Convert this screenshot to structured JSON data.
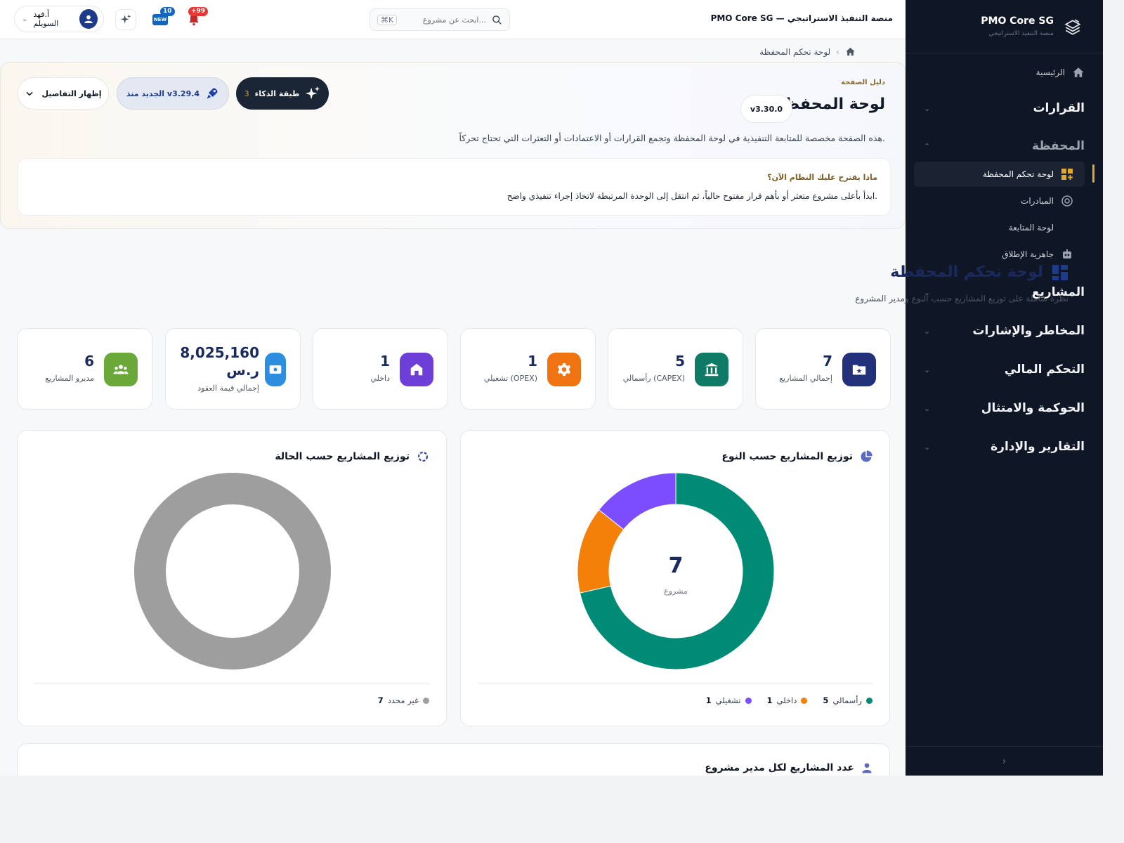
{
  "sidebar": {
    "brand_name": "PMO Core SG",
    "brand_sub": "منصة التنفيذ الاستراتيجي",
    "home_label": "الرئيسية",
    "groups": [
      {
        "label": "القرارات"
      },
      {
        "label": "المحفظة"
      },
      {
        "label": "المشاريع"
      },
      {
        "label": "المخاطر والإشارات"
      },
      {
        "label": "التحكم المالي"
      },
      {
        "label": "الحوكمة والامتثال"
      },
      {
        "label": "التقارير والإدارة"
      }
    ],
    "sub_items": [
      {
        "label": "لوحة تحكم المحفظة",
        "icon": "dashboard-icon"
      },
      {
        "label": "المبادرات",
        "icon": "initiatives-icon"
      },
      {
        "label": "لوحة المتابعة",
        "icon": ""
      },
      {
        "label": "جاهزية الإطلاق",
        "icon": "robot-icon"
      }
    ],
    "collapse_glyph": "›"
  },
  "topbar": {
    "title": "PMO Core SG — منصة التنفيذ الاستراتيجي",
    "search_placeholder": "ابحث عن مشروع...",
    "search_shortcut": "⌘K",
    "notif_badge": "+99",
    "new_badge": "10",
    "new_label": "NEW",
    "user_name": "أ.فهد السويلم"
  },
  "breadcrumb": {
    "current": "لوحة تحكم المحفظة"
  },
  "guide": {
    "kicker": "دليل الصفحة",
    "title": "لوحة المحفظة",
    "version": "v3.30.0",
    "description": "هذه الصفحة مخصصة للمتابعة التنفيذية في لوحة المحفظة وتجمع القرارات أو الاعتمادات أو التعثرات التي تحتاج تحركاً.",
    "suggest_title": "ماذا يقترح عليك النظام الآن؟",
    "suggest_text": "ابدأ بأعلى مشروع متعثر أو بأهم قرار مفتوح حالياً، ثم انتقل إلى الوحدة المرتبطة لاتخاذ إجراء تنفيذي واضح.",
    "ai_label": "طبقة الذكاء",
    "ai_count": "3",
    "new_since_label": "الجديد منذ v3.29.4",
    "details_label": "إظهار التفاصيل"
  },
  "section": {
    "title": "لوحة تحكم المحفظة",
    "subtitle": "نظرة شاملة على توزيع المشاريع حسب النوع ومدير المشروع"
  },
  "kpis": [
    {
      "value": "7",
      "label": "إجمالي المشاريع",
      "color": "#23307a",
      "icon": "folder-star-icon"
    },
    {
      "value": "5",
      "label": "رأسمالي (CAPEX)",
      "color": "#0f7a66",
      "icon": "bank-icon"
    },
    {
      "value": "1",
      "label": "تشغيلي (OPEX)",
      "color": "#f07312",
      "icon": "gear-icon"
    },
    {
      "value": "1",
      "label": "داخلي",
      "color": "#6d3fd8",
      "icon": "house-icon"
    },
    {
      "value": "8,025,160",
      "value2": "ر.س",
      "label": "إجمالي قيمة العقود",
      "color": "#2d8ee0",
      "icon": "money-icon"
    },
    {
      "value": "6",
      "label": "مديرو المشاريع",
      "color": "#6aa83a",
      "icon": "people-icon"
    }
  ],
  "charts": {
    "by_type_title": "توزيع المشاريع حسب النوع",
    "by_type_center_value": "7",
    "by_type_center_label": "مشروع",
    "by_status_title": "توزيع المشاريع حسب الحالة",
    "managers_title": "عدد المشاريع لكل مدير مشروع"
  },
  "chart_data": [
    {
      "type": "pie",
      "title": "توزيع المشاريع حسب النوع",
      "categories": [
        "رأسمالي",
        "داخلي",
        "تشغيلي"
      ],
      "values": [
        5,
        1,
        1
      ],
      "colors": [
        "#008b76",
        "#f47f09",
        "#7c4dff"
      ],
      "donut": true,
      "center_text": "7"
    },
    {
      "type": "pie",
      "title": "توزيع المشاريع حسب الحالة",
      "categories": [
        "غير محدد"
      ],
      "values": [
        7
      ],
      "colors": [
        "#9e9e9e"
      ],
      "donut": true
    }
  ]
}
